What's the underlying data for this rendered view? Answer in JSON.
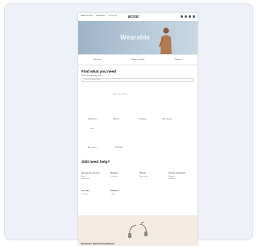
{
  "nav": {
    "links": [
      "HEADPHONES",
      "SPEAKERS",
      "SUPPORT"
    ],
    "logo": "BOSE"
  },
  "hero": {
    "title": "Wearable"
  },
  "tabs": [
    "Get started",
    "Register a product",
    "Contact us"
  ],
  "help": {
    "title": "Find what you need",
    "subtitle": "Search for support by product",
    "search_placeholder": "Search by product name"
  },
  "categories": {
    "hint": "Browse by category",
    "items": [
      "Headphones",
      "Speakers",
      "Soundbars",
      "Home theater",
      "Accessories",
      "Wearables"
    ]
  },
  "more": {
    "title": "Still need help?",
    "columns": [
      {
        "heading": "Manage your account",
        "links": [
          "Sign in",
          "Order status"
        ]
      },
      {
        "heading": "Shipping",
        "links": [
          "Track order"
        ]
      },
      {
        "heading": "Returns",
        "links": [
          "Start a return"
        ]
      },
      {
        "heading": "Product registration",
        "links": [
          "Register",
          "Warranty"
        ]
      },
      {
        "heading": "Live chat",
        "links": [
          "Chat now"
        ]
      },
      {
        "heading": "Contact us",
        "links": [
          "Call us"
        ]
      }
    ]
  },
  "promo": {
    "title": "Customer Service Excellence"
  },
  "colors": {
    "card_bg": "#eef2f8",
    "hero": "#9cb3c8",
    "promo": "#f4ebe2"
  }
}
